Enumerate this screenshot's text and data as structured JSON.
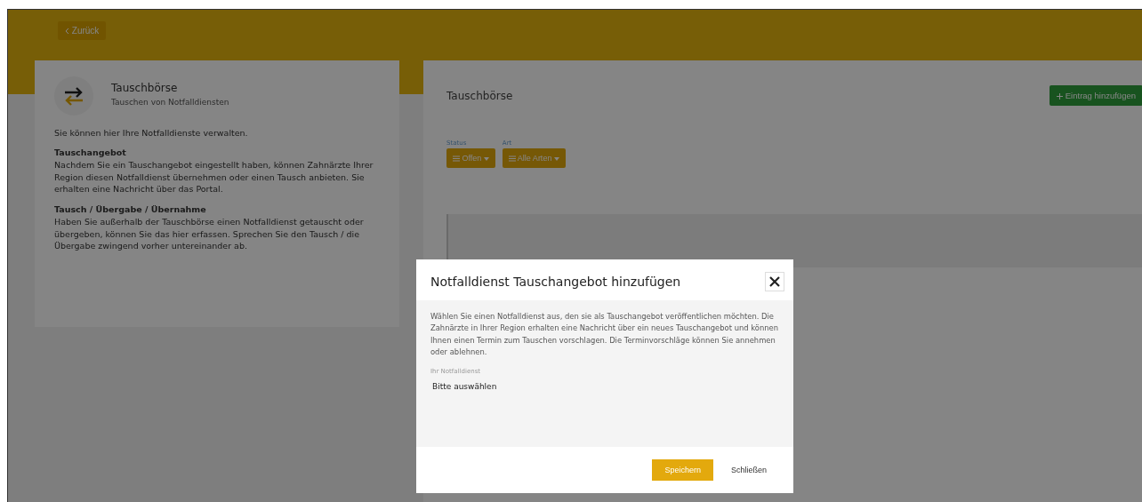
{
  "back_button": {
    "label": "Zurück"
  },
  "info_card": {
    "title": "Tauschbörse",
    "subtitle": "Tauschen von Notfalldiensten",
    "intro": "Sie können hier Ihre Notfalldienste verwalten.",
    "sections": [
      {
        "heading": "Tauschangebot",
        "text": "Nachdem Sie ein Tauschangebot eingestellt haben, können Zahnärzte Ihrer Region diesen Notfalldienst übernehmen oder einen Tausch anbieten. Sie erhalten eine Nachricht über das Portal."
      },
      {
        "heading": "Tausch / Übergabe / Übernahme",
        "text": "Haben Sie außerhalb der Tauschbörse einen Notfalldienst getauscht oder übergeben, können Sie das hier erfassen. Sprechen Sie den Tausch / die Übergabe zwingend vorher untereinander ab."
      }
    ]
  },
  "main_panel": {
    "title": "Tauschbörse",
    "add_button": "Eintrag hinzufügen",
    "filters": [
      {
        "label": "Status",
        "value": "Offen"
      },
      {
        "label": "Art",
        "value": "Alle Arten"
      }
    ]
  },
  "modal": {
    "title": "Notfalldienst Tauschangebot hinzufügen",
    "text": "Wählen Sie einen Notfalldienst aus, den sie als Tauschangebot veröffentlichen möchten. Die Zahnärzte in Ihrer Region erhalten eine Nachricht über ein neues Tauschangebot und können Ihnen einen Termin zum Tauschen vorschlagen. Die Terminvorschläge können Sie annehmen oder ablehnen.",
    "field": {
      "label": "Ihr Notfalldienst",
      "value": "Bitte auswählen"
    },
    "buttons": [
      {
        "label": "Speichern",
        "kind": "primary"
      },
      {
        "label": "Schließen",
        "kind": "link"
      }
    ]
  }
}
